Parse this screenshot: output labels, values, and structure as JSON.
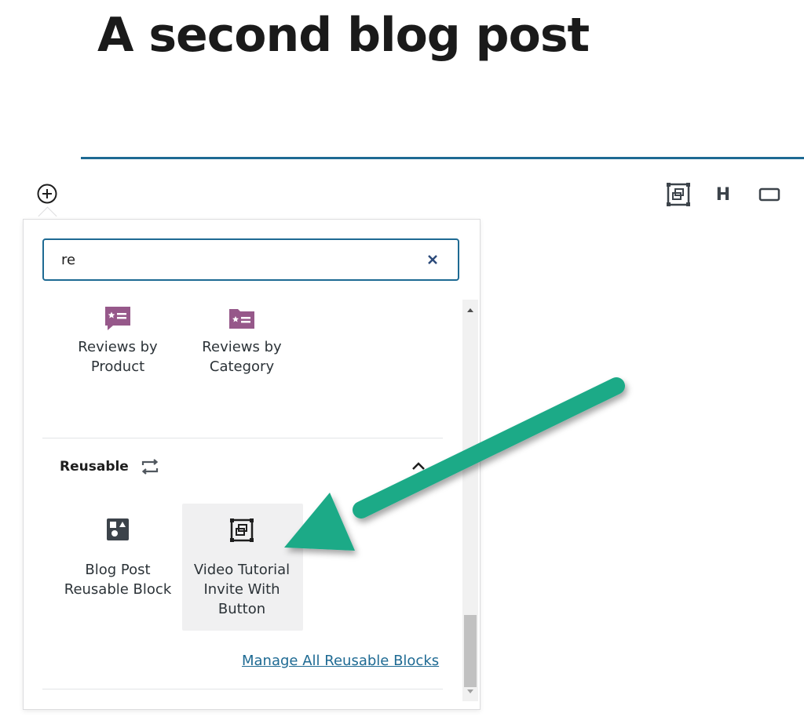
{
  "post": {
    "title": "A second blog post"
  },
  "block_toolbar": {
    "heading_label": "H"
  },
  "inserter": {
    "search": {
      "value": "re"
    },
    "results": [
      {
        "label_line1": "Reviews by",
        "label_line2": "Product",
        "icon": "review-product-icon"
      },
      {
        "label_line1": "Reviews by",
        "label_line2": "Category",
        "icon": "review-category-icon"
      }
    ],
    "reusable_section": {
      "title": "Reusable",
      "items": [
        {
          "label_line1": "Blog Post",
          "label_line2": "Reusable Block",
          "icon": "reusable-block-icon"
        },
        {
          "label_line1": "Video Tutorial",
          "label_line2": "Invite With",
          "label_line3": "Button",
          "icon": "group-block-icon"
        }
      ],
      "manage_link": "Manage All Reusable Blocks"
    }
  },
  "colors": {
    "accent": "#1e6a93",
    "woo_purple": "#96588a",
    "annotation_arrow": "#1aaa87"
  }
}
